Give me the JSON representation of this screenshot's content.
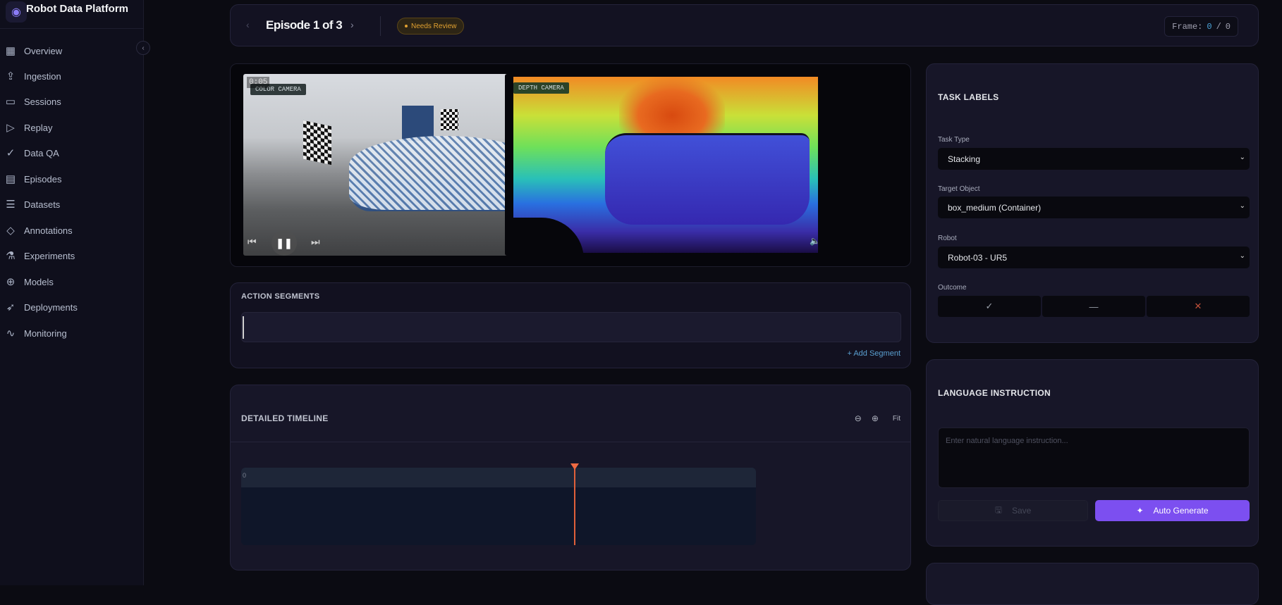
{
  "app": {
    "title": "Robot Data Platform"
  },
  "sidebar": {
    "items": [
      {
        "label": "Overview",
        "icon": "grid-icon"
      },
      {
        "label": "Ingestion",
        "icon": "upload-icon"
      },
      {
        "label": "Sessions",
        "icon": "video-icon"
      },
      {
        "label": "Replay",
        "icon": "play-icon"
      },
      {
        "label": "Data QA",
        "icon": "check-circle-icon"
      },
      {
        "label": "Episodes",
        "icon": "film-icon"
      },
      {
        "label": "Datasets",
        "icon": "database-icon"
      },
      {
        "label": "Annotations",
        "icon": "tag-icon"
      },
      {
        "label": "Experiments",
        "icon": "flask-icon"
      },
      {
        "label": "Models",
        "icon": "brain-icon"
      },
      {
        "label": "Deployments",
        "icon": "rocket-icon"
      },
      {
        "label": "Monitoring",
        "icon": "activity-icon"
      }
    ]
  },
  "header": {
    "episode": "Episode 1 of 3",
    "status": "Needs Review",
    "frame_label": "Frame:",
    "frame_current": "0",
    "frame_sep": "/",
    "frame_total": "0"
  },
  "video": {
    "color_label": "COLOR CAMERA",
    "depth_label": "DEPTH CAMERA",
    "time": "0:05"
  },
  "actions": {
    "title": "ACTION SEGMENTS",
    "add_label": "+ Add Segment"
  },
  "timeline": {
    "title": "DETAILED TIMELINE",
    "fit": "Fit",
    "zero": "0"
  },
  "task_labels": {
    "title": "TASK LABELS",
    "task_type_label": "Task Type",
    "task_type": "Stacking",
    "target_label": "Target Object",
    "target": "box_medium (Container)",
    "robot_label": "Robot",
    "robot": "Robot-03 - UR5",
    "outcome_label": "Outcome",
    "outcome_success": "✓",
    "outcome_neutral": "—",
    "outcome_fail": "✕"
  },
  "language": {
    "title": "LANGUAGE INSTRUCTION",
    "placeholder": "Enter natural language instruction...",
    "save": "Save",
    "auto": "Auto Generate"
  },
  "colors": {
    "accent": "#7c4ff0",
    "playhead": "#e0603a",
    "warning": "#e0a030"
  }
}
